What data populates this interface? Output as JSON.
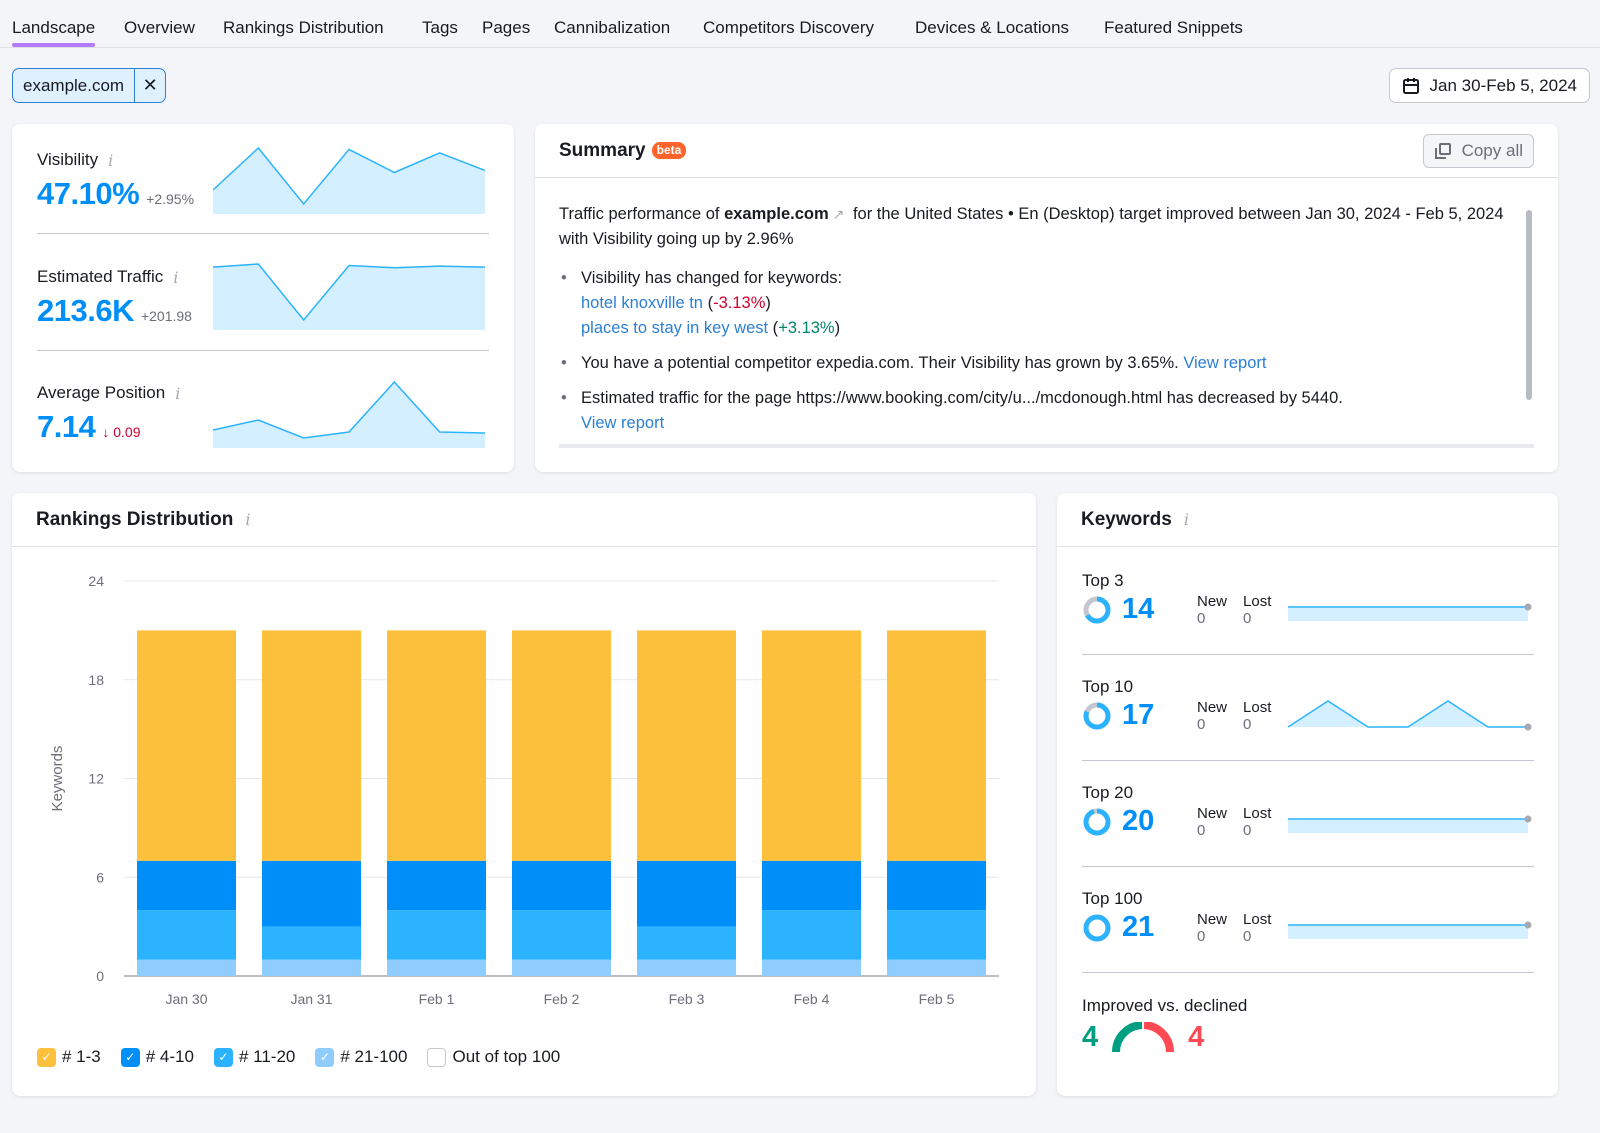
{
  "tabs": [
    {
      "label": "Landscape",
      "active": true
    },
    {
      "label": "Overview"
    },
    {
      "label": "Rankings Distribution"
    },
    {
      "label": "Tags"
    },
    {
      "label": "Pages"
    },
    {
      "label": "Cannibalization"
    },
    {
      "label": "Competitors Discovery"
    },
    {
      "label": "Devices & Locations"
    },
    {
      "label": "Featured Snippets"
    }
  ],
  "filter": {
    "domain": "example.com",
    "close_icon": "close-icon"
  },
  "date_range": {
    "label": "Jan 30-Feb 5, 2024",
    "icon": "calendar-icon"
  },
  "metrics": [
    {
      "label": "Visibility",
      "value": "47.10%",
      "delta": "+2.95%",
      "direction": "up",
      "trend": [
        44,
        50,
        42,
        49.8,
        46.5,
        49.3,
        46.8
      ]
    },
    {
      "label": "Estimated Traffic",
      "value": "213.6K",
      "delta": "+201.98",
      "direction": "up",
      "trend": [
        212,
        213,
        195,
        212.5,
        211.8,
        212.3,
        212
      ]
    },
    {
      "label": "Average Position",
      "value": "7.14",
      "delta": "0.09",
      "direction": "down",
      "trend": [
        7.18,
        7.23,
        7.14,
        7.17,
        7.42,
        7.17,
        7.165
      ]
    }
  ],
  "summary": {
    "title": "Summary",
    "badge": "beta",
    "copy_label": "Copy all",
    "intro_prefix": "Traffic performance of ",
    "intro_domain": "example.com",
    "intro_suffix": " for the United States • En (Desktop) target improved between Jan 30, 2024 - Feb 5, 2024 with Visibility going up by 2.96%",
    "bullets": {
      "keywords_heading": "Visibility has changed for keywords:",
      "kw1": "hotel knoxville tn",
      "kw1_change": "-3.13%",
      "kw2": "places to stay in key west",
      "kw2_change": "+3.13%",
      "competitor_text": "You have a potential competitor expedia.com. Their Visibility has grown by 3.65%.",
      "traffic_text": "Estimated traffic for the page https://www.booking.com/city/u.../mcdonough.html has decreased by 5440.",
      "view_report": "View report"
    }
  },
  "rankings": {
    "title": "Rankings Distribution",
    "legend": [
      {
        "label": "# 1-3",
        "color": "#fdc03d",
        "checked": true
      },
      {
        "label": "# 4-10",
        "color": "#008ff8",
        "checked": true
      },
      {
        "label": "# 11-20",
        "color": "#2bb3ff",
        "checked": true
      },
      {
        "label": "# 21-100",
        "color": "#8fcdff",
        "checked": true
      },
      {
        "label": "Out of top 100",
        "color": "#ffffff",
        "checked": false
      }
    ]
  },
  "chart_data": {
    "type": "bar",
    "stacked": true,
    "title": "Rankings Distribution",
    "xlabel": "",
    "ylabel": "Keywords",
    "ylim": [
      0,
      24
    ],
    "yticks": [
      0,
      6,
      12,
      18,
      24
    ],
    "grid": true,
    "legend_position": "bottom-left",
    "categories": [
      "Jan 30",
      "Jan 31",
      "Feb 1",
      "Feb 2",
      "Feb 3",
      "Feb 4",
      "Feb 5"
    ],
    "series": [
      {
        "name": "# 21-100",
        "color": "#8fcdff",
        "values": [
          1,
          1,
          1,
          1,
          1,
          1,
          1
        ]
      },
      {
        "name": "# 11-20",
        "color": "#2bb3ff",
        "values": [
          3,
          2,
          3,
          3,
          2,
          3,
          3
        ]
      },
      {
        "name": "# 4-10",
        "color": "#008ff8",
        "values": [
          3,
          4,
          3,
          3,
          4,
          3,
          3
        ]
      },
      {
        "name": "# 1-3",
        "color": "#fdc03d",
        "values": [
          14,
          14,
          14,
          14,
          14,
          14,
          14
        ]
      }
    ]
  },
  "keywords": {
    "title": "Keywords",
    "new_label": "New",
    "lost_label": "Lost",
    "rows": [
      {
        "label": "Top 3",
        "count": "14",
        "fraction": 0.667,
        "new": "0",
        "lost": "0",
        "trend": [
          14,
          14,
          14,
          14,
          14,
          14,
          14
        ]
      },
      {
        "label": "Top 10",
        "count": "17",
        "fraction": 0.81,
        "new": "0",
        "lost": "0",
        "trend": [
          17,
          18,
          17,
          17,
          18,
          17,
          17
        ]
      },
      {
        "label": "Top 20",
        "count": "20",
        "fraction": 0.95,
        "new": "0",
        "lost": "0",
        "trend": [
          20,
          20,
          20,
          20,
          20,
          20,
          20
        ]
      },
      {
        "label": "Top 100",
        "count": "21",
        "fraction": 1.0,
        "new": "0",
        "lost": "0",
        "trend": [
          21,
          21,
          21,
          21,
          21,
          21,
          21
        ]
      }
    ],
    "improved_label": "Improved vs. declined",
    "improved": "4",
    "declined": "4",
    "improved_color": "#009f81",
    "declined_color": "#ff4953"
  }
}
